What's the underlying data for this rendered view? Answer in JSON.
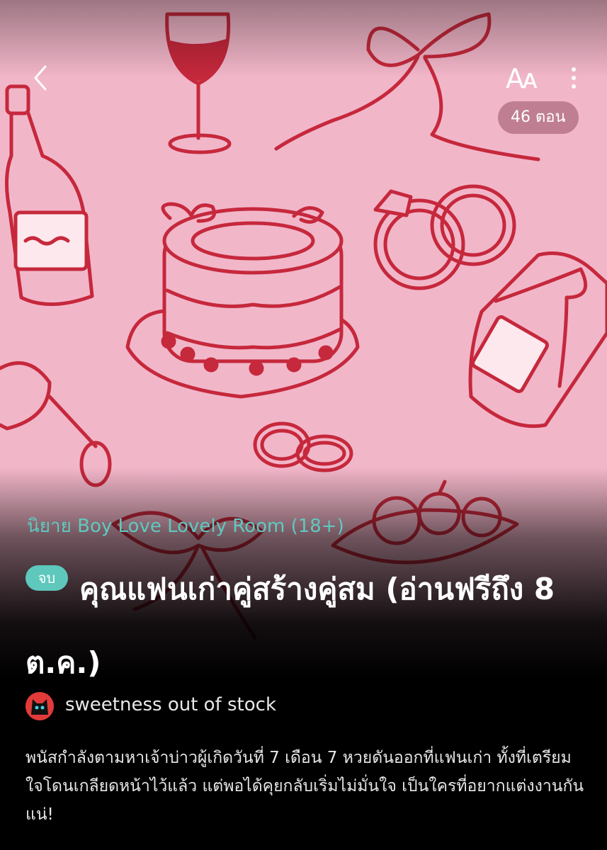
{
  "header": {
    "back_icon": "chevron-left-icon",
    "font_size_label": "Aᴀ",
    "more_icon": "more-vertical-icon",
    "episode_count": "46 ตอน"
  },
  "novel": {
    "category": "นิยาย Boy Love Lovely Room (18+)",
    "status_badge": "จบ",
    "title": "คุณแฟนเก่าคู่สร้างคู่สม (อ่านฟรีถึง 8 ต.ค.)",
    "author": "sweetness out of stock",
    "synopsis": "พนัสกำลังตามหาเจ้าบ่าวผู้เกิดวันที่ 7 เดือน 7 หวยดันออกที่แฟนเก่า ทั้งที่เตรียมใจโดนเกลียดหน้าไว้แล้ว แต่พอได้คุยกลับเริ่มไม่มั่นใจ เป็นใครที่อยากแต่งงานกันแน่!"
  },
  "colors": {
    "cover_background": "#f2b6c9",
    "illustration_stroke": "#c6283c",
    "accent": "#5ec8bd",
    "page_background": "#000000"
  }
}
